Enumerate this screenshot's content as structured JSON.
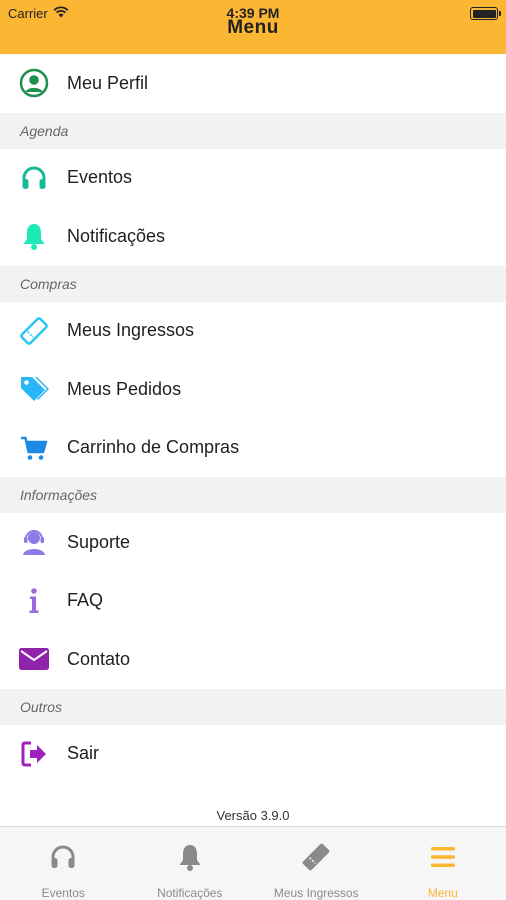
{
  "status_bar": {
    "carrier": "Carrier",
    "time": "4:39 PM"
  },
  "header": {
    "title": "Menu"
  },
  "menu": {
    "profile": {
      "label": "Meu Perfil",
      "icon": "user-circle-icon",
      "color": "#1f8f4e"
    },
    "sections": [
      {
        "title": "Agenda",
        "items": [
          {
            "label": "Eventos",
            "icon": "headphones-icon",
            "color": "#17b897"
          },
          {
            "label": "Notificações",
            "icon": "bell-icon",
            "color": "#1de9b6"
          }
        ]
      },
      {
        "title": "Compras",
        "items": [
          {
            "label": "Meus Ingressos",
            "icon": "ticket-icon",
            "color": "#29c5f6"
          },
          {
            "label": "Meus Pedidos",
            "icon": "tags-icon",
            "color": "#29b6f6"
          },
          {
            "label": "Carrinho de Compras",
            "icon": "cart-icon",
            "color": "#1e88e5"
          }
        ]
      },
      {
        "title": "Informações",
        "items": [
          {
            "label": "Suporte",
            "icon": "support-agent-icon",
            "color": "#8c7ae6"
          },
          {
            "label": "FAQ",
            "icon": "info-icon",
            "color": "#9c6ade"
          },
          {
            "label": "Contato",
            "icon": "envelope-icon",
            "color": "#8e24aa"
          }
        ]
      },
      {
        "title": "Outros",
        "items": [
          {
            "label": "Sair",
            "icon": "sign-out-icon",
            "color": "#a020c0"
          }
        ]
      }
    ]
  },
  "footer": {
    "version": "Versão 3.9.0"
  },
  "tabbar": {
    "tabs": [
      {
        "label": "Eventos",
        "icon": "headphones-icon",
        "active": false
      },
      {
        "label": "Notificações",
        "icon": "bell-icon",
        "active": false
      },
      {
        "label": "Meus Ingressos",
        "icon": "ticket-icon",
        "active": false
      },
      {
        "label": "Menu",
        "icon": "hamburger-menu-icon",
        "active": true
      }
    ],
    "inactive_color": "#8a8a8a",
    "active_color": "#fbb634"
  },
  "colors": {
    "header": "#fbb634",
    "section_bg": "#f2f2f2"
  }
}
